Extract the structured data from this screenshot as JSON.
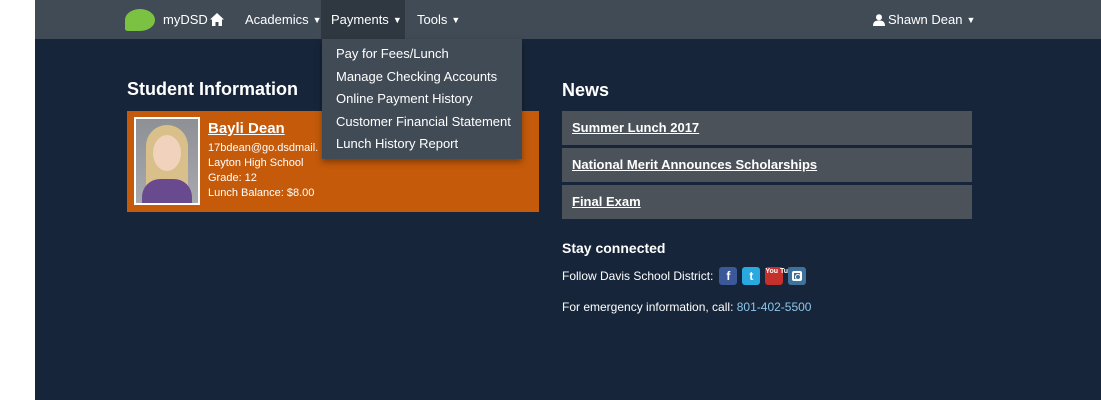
{
  "navbar": {
    "brand": "myDSD",
    "academics": "Academics",
    "payments": "Payments",
    "tools": "Tools",
    "user": "Shawn Dean"
  },
  "payments_menu": {
    "items": [
      "Pay for Fees/Lunch",
      "Manage Checking Accounts",
      "Online Payment History",
      "Customer Financial Statement",
      "Lunch History Report"
    ]
  },
  "student": {
    "section_title": "Student Information",
    "name": "Bayli Dean",
    "email": "17bdean@go.dsdmail.",
    "school": "Layton High School",
    "grade": "Grade: 12",
    "lunch_balance": "Lunch Balance: $8.00"
  },
  "news": {
    "section_title": "News",
    "items": [
      "Summer Lunch 2017",
      "National Merit Announces Scholarships",
      "Final Exam"
    ]
  },
  "stay_connected": {
    "title": "Stay connected",
    "follow_text": "Follow Davis School District:",
    "social": [
      "f",
      "t",
      "You Tube"
    ],
    "emergency_text": "For emergency information, call:",
    "phone": "801-402-5500"
  },
  "colors": {
    "navbar": "#414b56",
    "background": "#162539",
    "student_card": "#c45a0a",
    "news_item": "#4b5259",
    "link": "#8dc6e8",
    "brand_logo": "#7cc242"
  }
}
